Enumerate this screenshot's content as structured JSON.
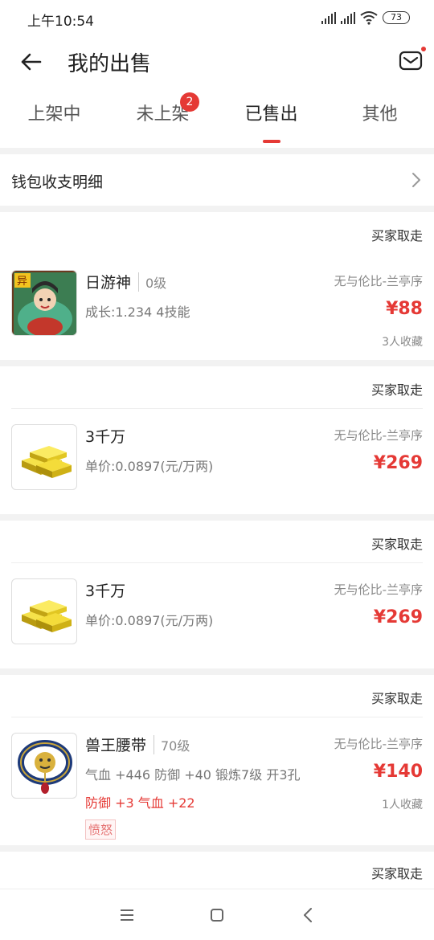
{
  "status_bar": {
    "time": "上午10:54",
    "battery": "73"
  },
  "header": {
    "title": "我的出售"
  },
  "tabs": [
    {
      "label": "上架中"
    },
    {
      "label": "未上架",
      "badge": "2"
    },
    {
      "label": "已售出"
    },
    {
      "label": "其他"
    }
  ],
  "wallet": {
    "label": "钱包收支明细"
  },
  "orders": [
    {
      "status": "买家取走",
      "name": "日游神",
      "level": "0级",
      "detail": "成长:1.234 4技能",
      "server": "无与伦比-兰亭序",
      "price": "¥88",
      "favorites": "3人收藏"
    },
    {
      "status": "买家取走",
      "name": "3千万",
      "detail": "单价:0.0897(元/万两)",
      "server": "无与伦比-兰亭序",
      "price": "¥269"
    },
    {
      "status": "买家取走",
      "name": "3千万",
      "detail": "单价:0.0897(元/万两)",
      "server": "无与伦比-兰亭序",
      "price": "¥269"
    },
    {
      "status": "买家取走",
      "name": "兽王腰带",
      "level": "70级",
      "detail": "气血 +446 防御 +40 锻炼7级 开3孔",
      "detail_red": "防御 +3 气血 +22",
      "tag": "愤怒",
      "server": "无与伦比-兰亭序",
      "price": "¥140",
      "favorites": "1人收藏"
    },
    {
      "status": "买家取走"
    }
  ],
  "colors": {
    "accent": "#e53935",
    "background": "#f2f2f2"
  }
}
